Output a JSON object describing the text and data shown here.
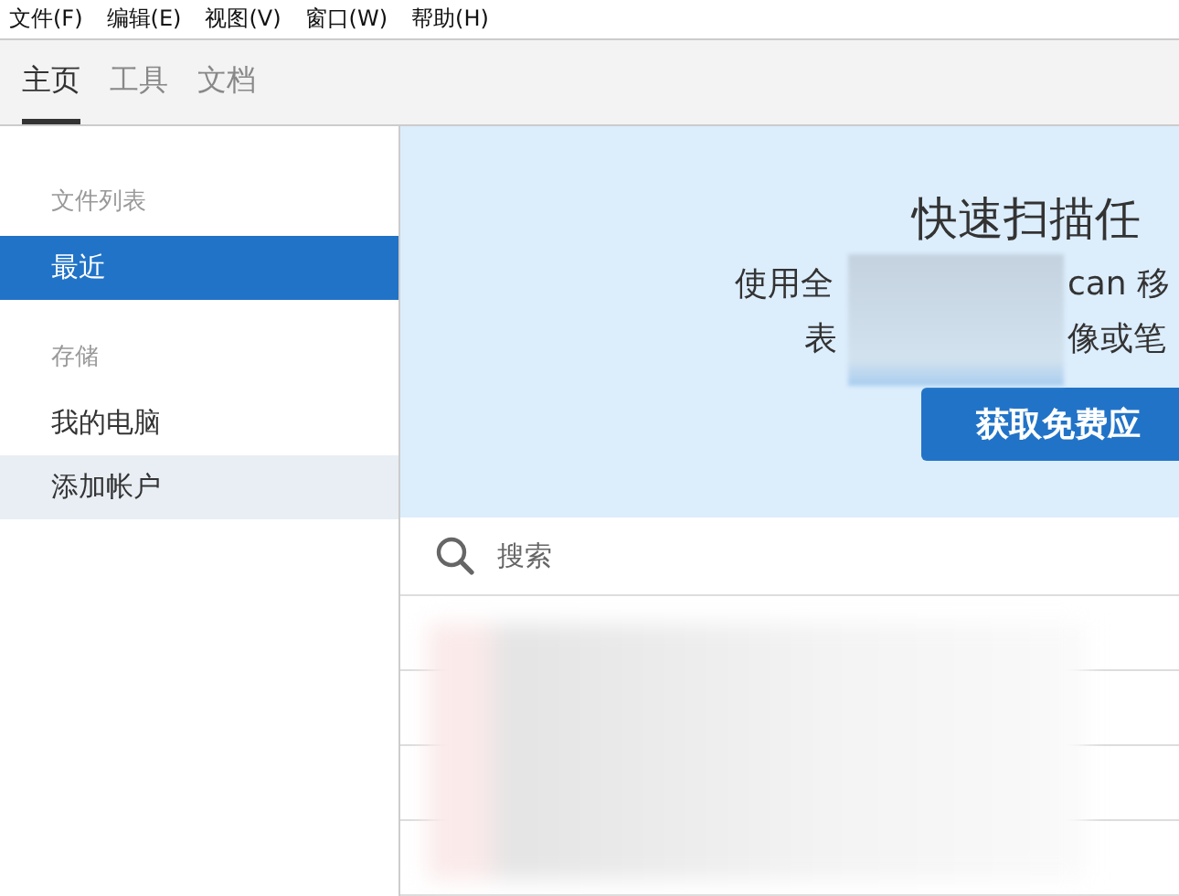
{
  "menu": [
    "文件(F)",
    "编辑(E)",
    "视图(V)",
    "窗口(W)",
    "帮助(H)"
  ],
  "tabs": [
    {
      "label": "主页",
      "selected": true
    },
    {
      "label": "工具",
      "selected": false
    },
    {
      "label": "文档",
      "selected": false
    }
  ],
  "sidebar": {
    "sections": [
      {
        "heading": "文件列表",
        "items": [
          {
            "label": "最近",
            "selected": true,
            "highlighted": false
          }
        ]
      },
      {
        "heading": "存储",
        "items": [
          {
            "label": "我的电脑",
            "selected": false,
            "highlighted": false
          },
          {
            "label": "添加帐户",
            "selected": false,
            "highlighted": true
          }
        ]
      }
    ]
  },
  "banner": {
    "title": "快速扫描任",
    "line_1": [
      "使用全",
      "can 移"
    ],
    "line_2": [
      "表",
      "像或笔"
    ],
    "button": "获取免费应"
  },
  "search": {
    "placeholder": "搜索"
  }
}
